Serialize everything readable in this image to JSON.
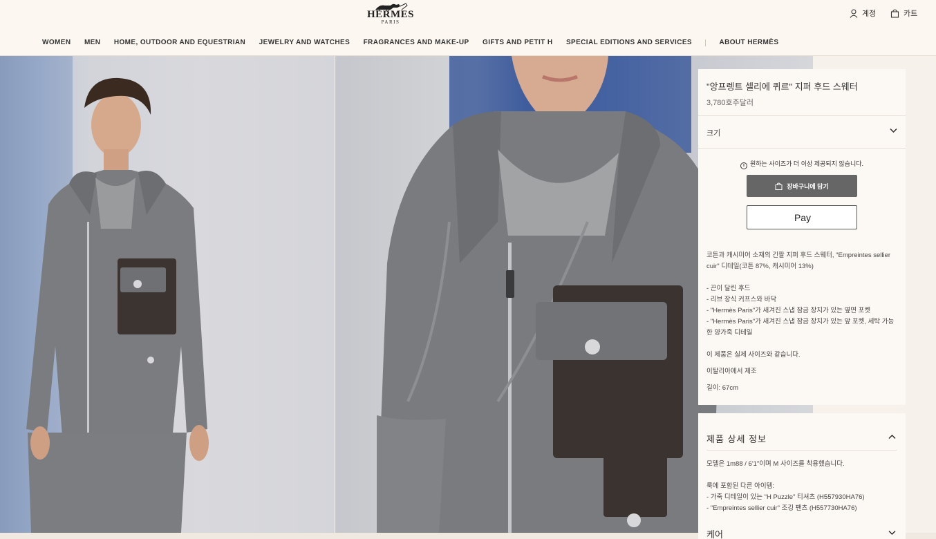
{
  "header": {
    "brand": "HERMES",
    "brand_city": "PARIS",
    "account_label": "계정",
    "cart_label": "카트"
  },
  "nav": {
    "items": [
      "WOMEN",
      "MEN",
      "HOME, OUTDOOR AND EQUESTRIAN",
      "JEWELRY AND WATCHES",
      "FRAGRANCES AND MAKE-UP",
      "GIFTS AND PETIT H",
      "SPECIAL EDITIONS AND SERVICES",
      "ABOUT HERMÈS"
    ]
  },
  "product": {
    "title": "\"앙프렝트 셀리에 퀴르\" 지퍼 후드 스웨터",
    "price": "3,780호주달러",
    "size_label": "크기",
    "notice": "원하는 사이즈가 더 이상 제공되지 않습니다.",
    "add_to_cart": "장바구니에 담기",
    "pay_label": "Pay",
    "description": [
      "코튼과 캐시미어 소재의 긴팔 지퍼 후드 스웨터, \"Empreintes sellier cuir\" 디테일(코튼 87%, 캐시미어 13%)",
      "- 끈이 달린 후드",
      "- 리브 장식 커프스와 바닥",
      "- \"Hermès Paris\"가 새겨진 스냅 잠금 장치가 있는 옆면 포켓",
      "- \"Hermès Paris\"가 새겨진 스냅 잠금 장치가 있는 앞 포켓, 세탁 가능한 양가죽 디테일",
      "이 제품은 실제 사이즈와 같습니다.",
      "이탈리아에서 제조",
      "길이: 67cm"
    ]
  },
  "details": {
    "title": "제품 상세 정보",
    "model_info": "모델은 1m88 / 6'1\"이며 M 사이즈를 착용했습니다.",
    "included_label": "룩에 포함된 다른 아이템:",
    "included_items": [
      "- 가죽 디테일이 있는 \"H Puzzle\" 티셔츠 (H557930HA76)",
      "- \"Empreintes sellier cuir\" 조깅 팬츠 (H557730HA76)"
    ],
    "care_title": "케어"
  }
}
